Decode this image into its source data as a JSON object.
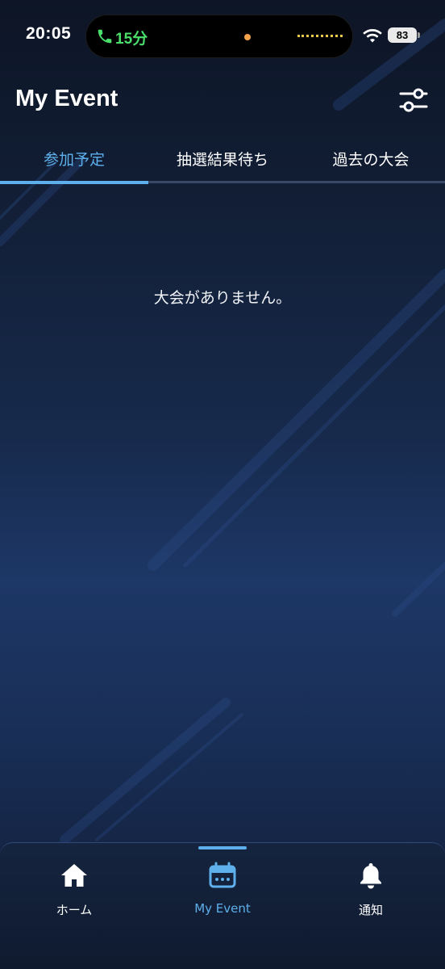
{
  "status_bar": {
    "time": "20:05",
    "call_duration": "15分",
    "battery": "83",
    "icons": [
      "phone-icon",
      "wifi-icon",
      "battery-icon"
    ]
  },
  "header": {
    "title": "My Event",
    "filter_icon": "sliders-icon"
  },
  "tabs": [
    {
      "label": "参加予定",
      "active": true
    },
    {
      "label": "抽選結果待ち",
      "active": false
    },
    {
      "label": "過去の大会",
      "active": false
    }
  ],
  "main": {
    "empty_message": "大会がありません。"
  },
  "bottom_nav": [
    {
      "label": "ホーム",
      "icon": "home-icon",
      "active": false
    },
    {
      "label": "My Event",
      "icon": "calendar-icon",
      "active": true
    },
    {
      "label": "通知",
      "icon": "bell-icon",
      "active": false
    }
  ],
  "colors": {
    "accent": "#5db0ec",
    "background": "#172a4c",
    "call_green": "#4ade6b"
  }
}
